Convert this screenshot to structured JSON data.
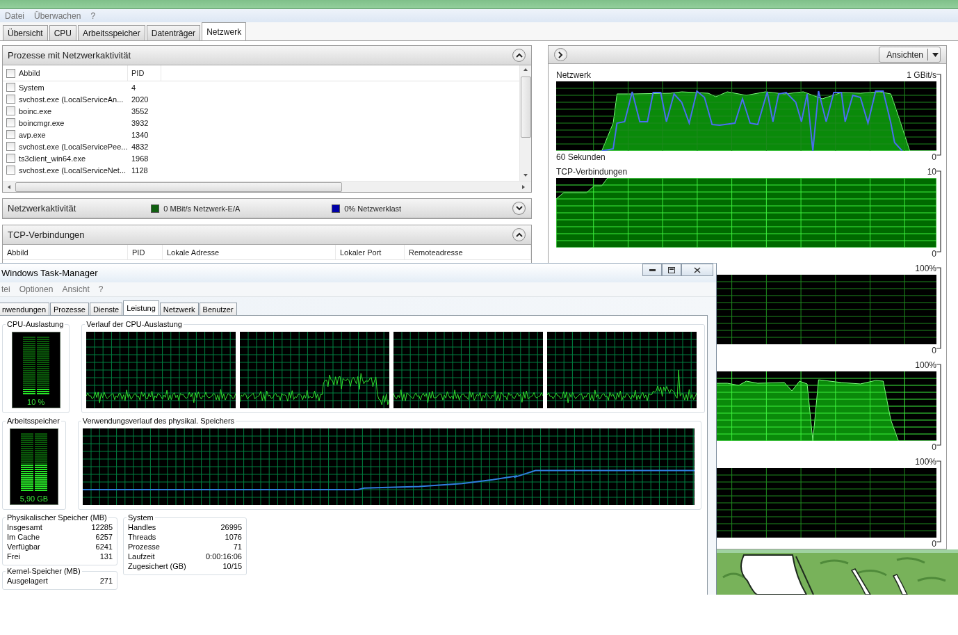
{
  "resource_monitor": {
    "menu": [
      "Datei",
      "Überwachen",
      "?"
    ],
    "tabs": [
      {
        "label": "Übersicht",
        "selected": false
      },
      {
        "label": "CPU",
        "selected": false
      },
      {
        "label": "Arbeitsspeicher",
        "selected": false
      },
      {
        "label": "Datenträger",
        "selected": false
      },
      {
        "label": "Netzwerk",
        "selected": true
      }
    ],
    "processes_panel": {
      "title": "Prozesse mit Netzwerkaktivität",
      "expanded": true,
      "header_checked": false,
      "columns": [
        "Abbild",
        "PID"
      ],
      "rows": [
        {
          "image": "System",
          "pid": "4",
          "checked": false
        },
        {
          "image": "svchost.exe (LocalServiceAn...",
          "pid": "2020",
          "checked": false
        },
        {
          "image": "boinc.exe",
          "pid": "3552",
          "checked": false
        },
        {
          "image": "boincmgr.exe",
          "pid": "3932",
          "checked": false
        },
        {
          "image": "avp.exe",
          "pid": "1340",
          "checked": false
        },
        {
          "image": "svchost.exe (LocalServicePee...",
          "pid": "4832",
          "checked": false
        },
        {
          "image": "ts3client_win64.exe",
          "pid": "1968",
          "checked": false
        },
        {
          "image": "svchost.exe (LocalServiceNet...",
          "pid": "1128",
          "checked": false
        }
      ]
    },
    "activity_panel": {
      "title": "Netzwerkaktivität",
      "expanded": false,
      "legend": [
        {
          "label": "0 MBit/s Netzwerk-E/A",
          "color": "#106010"
        },
        {
          "label": "0% Netzwerklast",
          "color": "#0000a8"
        }
      ]
    },
    "tcp_panel": {
      "title": "TCP-Verbindungen",
      "expanded": true,
      "columns": [
        "Abbild",
        "PID",
        "Lokale Adresse",
        "Lokaler Port",
        "Remoteadresse"
      ]
    },
    "graph_pane": {
      "views_button": "Ansichten",
      "graphs": [
        {
          "kind": "network",
          "title": "Netzwerk",
          "max": "1 GBit/s",
          "min": "0",
          "time": "60 Sekunden"
        },
        {
          "kind": "connections",
          "title": "TCP-Verbindungen",
          "max": "10",
          "min": "0"
        },
        {
          "kind": "idle",
          "max": "100%",
          "min": "0"
        },
        {
          "kind": "load",
          "max": "100%",
          "min": "0"
        },
        {
          "kind": "idle",
          "max": "100%",
          "min": "0"
        }
      ]
    }
  },
  "task_manager": {
    "title": "Windows Task-Manager",
    "menu": [
      "tei",
      "Optionen",
      "Ansicht",
      "?"
    ],
    "tabs": [
      {
        "label": "nwendungen",
        "selected": false
      },
      {
        "label": "Prozesse",
        "selected": false
      },
      {
        "label": "Dienste",
        "selected": false
      },
      {
        "label": "Leistung",
        "selected": true
      },
      {
        "label": "Netzwerk",
        "selected": false
      },
      {
        "label": "Benutzer",
        "selected": false
      }
    ],
    "cpu_meter": {
      "title": "CPU-Auslastung",
      "reading": "10 %",
      "level": 0.1
    },
    "cpu_history": {
      "title": "Verlauf der CPU-Auslastung"
    },
    "memory_meter": {
      "title": "Arbeitsspeicher",
      "reading": "5,90 GB",
      "level": 0.48
    },
    "memory_history": {
      "title": "Verwendungsverlauf des physikal. Speichers"
    },
    "physical_memory": {
      "title": "Physikalischer Speicher (MB)",
      "rows": [
        {
          "label": "Insgesamt",
          "value": "12285"
        },
        {
          "label": "Im Cache",
          "value": "6257"
        },
        {
          "label": "Verfügbar",
          "value": "6241"
        },
        {
          "label": "Frei",
          "value": "131"
        }
      ]
    },
    "system": {
      "title": "System",
      "rows": [
        {
          "label": "Handles",
          "value": "26995"
        },
        {
          "label": "Threads",
          "value": "1076"
        },
        {
          "label": "Prozesse",
          "value": "71"
        },
        {
          "label": "Laufzeit",
          "value": "0:00:16:06"
        },
        {
          "label": "Zugesichert (GB)",
          "value": "10/15"
        }
      ]
    },
    "kernel_memory": {
      "title": "Kernel-Speicher (MB)",
      "rows": [
        {
          "label": "Ausgelagert",
          "value": "271"
        }
      ]
    }
  }
}
